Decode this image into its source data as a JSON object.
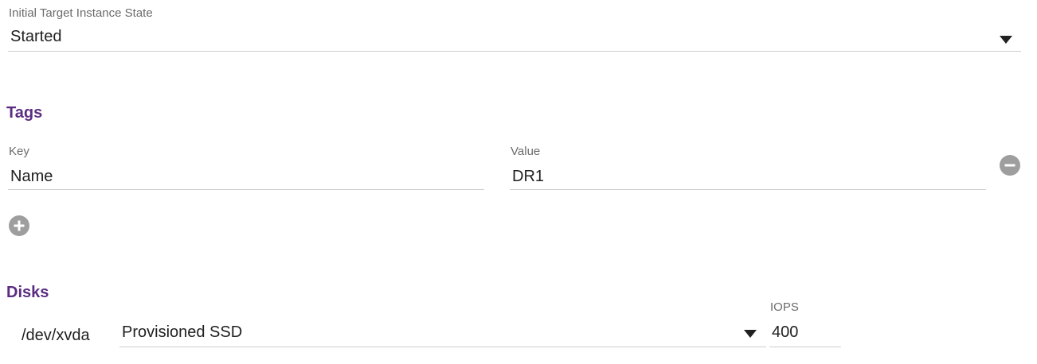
{
  "initial_state": {
    "label": "Initial Target Instance State",
    "value": "Started"
  },
  "tags": {
    "title": "Tags",
    "key_label": "Key",
    "key_value": "Name",
    "value_label": "Value",
    "value_value": "DR1"
  },
  "disks": {
    "title": "Disks",
    "device": "/dev/xvda",
    "type": "Provisioned SSD",
    "iops_label": "IOPS",
    "iops_value": "400"
  },
  "icons": {
    "remove": "minus-circle-icon",
    "add": "plus-circle-icon",
    "dropdown": "caret-down-icon"
  },
  "colors": {
    "section_title": "#5b2d82",
    "icon_gray": "#9e9e9e",
    "underline": "#cfcfcf"
  }
}
